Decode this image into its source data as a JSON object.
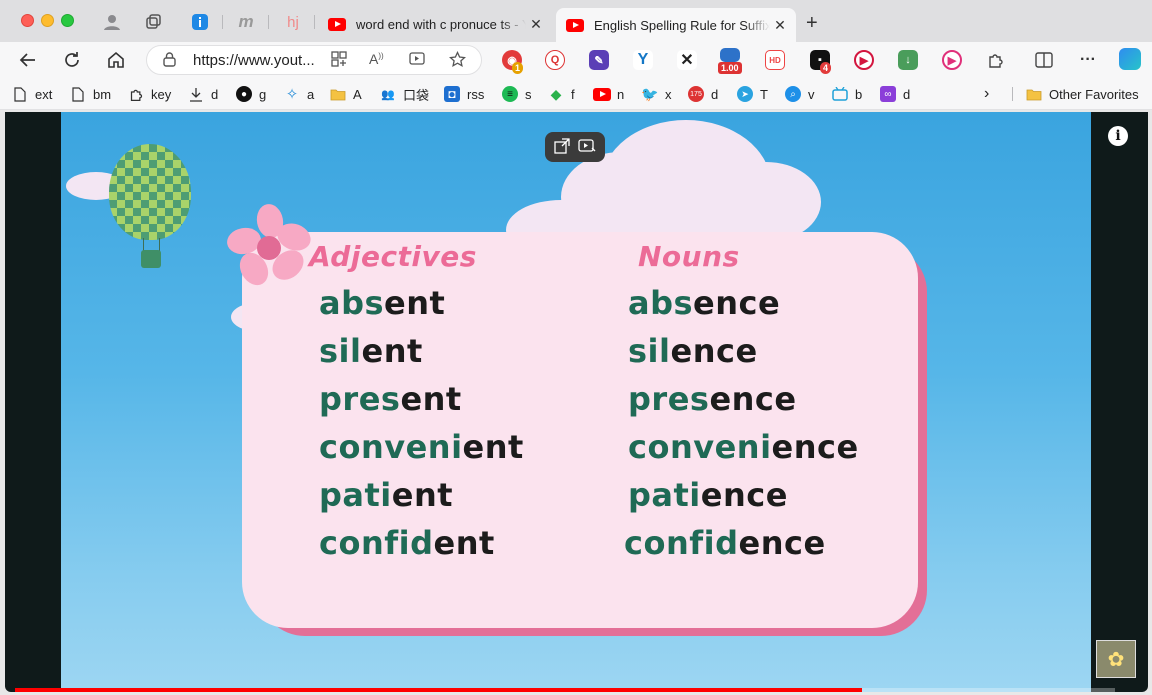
{
  "browser": {
    "tabs": [
      {
        "title": "word end with c pronuce ts - Y",
        "active": false
      },
      {
        "title": "English Spelling Rule for Suffix",
        "active": true
      }
    ],
    "pinned_tab_glyphs": [
      "m",
      "hj"
    ],
    "url": "https://www.yout...",
    "extension_badges": {
      "ext1": "1",
      "ext_speed": "1.00",
      "ext_hd": "HD",
      "ext_notif": "4"
    }
  },
  "bookmarks": [
    {
      "label": "ext",
      "icon": "page-icon"
    },
    {
      "label": "bm",
      "icon": "page-icon"
    },
    {
      "label": "key",
      "icon": "puzzle-icon"
    },
    {
      "label": "d",
      "icon": "download-icon"
    },
    {
      "label": "g",
      "icon": "github-icon"
    },
    {
      "label": "a",
      "icon": "star-icon"
    },
    {
      "label": "A",
      "icon": "folder-icon"
    },
    {
      "label": "口袋",
      "icon": "people-icon"
    },
    {
      "label": "rss",
      "icon": "rss-icon"
    },
    {
      "label": "s",
      "icon": "spotify-icon"
    },
    {
      "label": "f",
      "icon": "feedly-icon"
    },
    {
      "label": "n",
      "icon": "youtube-icon"
    },
    {
      "label": "x",
      "icon": "twitter-icon"
    },
    {
      "label": "d",
      "icon": "badge-icon",
      "badge": "175"
    },
    {
      "label": "T",
      "icon": "telegram-icon"
    },
    {
      "label": "v",
      "icon": "search-icon"
    },
    {
      "label": "b",
      "icon": "bilibili-icon"
    },
    {
      "label": "d",
      "icon": "app-icon"
    }
  ],
  "other_favorites": "Other Favorites",
  "video": {
    "headings": {
      "left": "Adjectives",
      "right": "Nouns"
    },
    "adjectives": [
      {
        "stem": "abs",
        "suffix": "ent"
      },
      {
        "stem": "sil",
        "suffix": "ent"
      },
      {
        "stem": "pres",
        "suffix": "ent"
      },
      {
        "stem": "conveni",
        "suffix": "ent"
      },
      {
        "stem": "pati",
        "suffix": "ent"
      },
      {
        "stem": "confid",
        "suffix": "ent"
      }
    ],
    "nouns": [
      {
        "stem": "abs",
        "suffix": "ence"
      },
      {
        "stem": "sil",
        "suffix": "ence"
      },
      {
        "stem": "pres",
        "suffix": "ence"
      },
      {
        "stem": "conveni",
        "suffix": "ence"
      },
      {
        "stem": "pati",
        "suffix": "ence"
      },
      {
        "stem": "confid",
        "suffix": "ence"
      }
    ],
    "progress": 0.77,
    "colors": {
      "stem": "#1f6a55",
      "suffix": "#1c1c1c",
      "heading": "#ec6b97",
      "card": "#fbe3ee",
      "progress": "#ff0000"
    }
  }
}
